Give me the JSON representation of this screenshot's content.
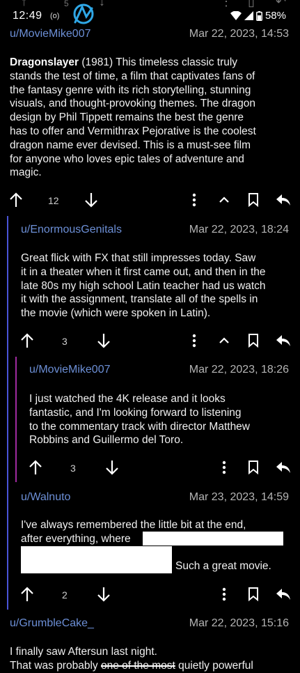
{
  "status": {
    "time": "12:49",
    "battery": "58%",
    "small_indicator": "(o)"
  },
  "comments": [
    {
      "author": "u/MovieMike007",
      "date": "Mar 22, 2023, 14:53",
      "title": "Dragonslayer",
      "lines": [
        " (1981) This timeless classic truly",
        "stands the test of time, a film that captivates fans of",
        "the fantasy genre with its rich storytelling, stunning",
        "visuals, and thought-provoking themes. The dragon",
        "design by Phil Tippett remains the best the genre",
        "has to offer and Vermithrax Pejorative is the coolest",
        "dragon name ever devised.  This is a must-see film",
        "for anyone who loves epic tales of adventure and",
        "magic."
      ],
      "votes": "12"
    },
    {
      "author": "u/EnormousGenitals",
      "date": "Mar 22, 2023, 18:24",
      "lines": [
        "Great flick with FX that still impresses today. Saw",
        "it in a theater when it first came out, and then in the",
        "late 80s my high school Latin teacher had us watch",
        "it with the assignment, translate all of the spells in",
        "the movie (which were spoken in Latin)."
      ],
      "votes": "3"
    },
    {
      "author": "u/MovieMike007",
      "date": "Mar 22, 2023, 18:26",
      "lines": [
        "I just watched the 4K release and it looks",
        "fantastic, and I'm looking forward to listening",
        "to the commentary track with director Matthew",
        "Robbins and Guillermo del Toro."
      ],
      "votes": "3"
    },
    {
      "author": "u/Walnuto",
      "date": "Mar 23, 2023, 14:59",
      "lines": [
        "I've always remembered the little bit at the end,",
        "after everything, where"
      ],
      "tail": "Such a great movie.",
      "votes": "2"
    },
    {
      "author": "u/GrumbleCake_",
      "date": "Mar 22, 2023, 15:16",
      "line1": "I finally saw Aftersun last night.",
      "line2_pre": "That was probably ",
      "line2_strike": "one of the most",
      "line2_post": " quietly powerful"
    }
  ],
  "colors": {
    "author": "#6c8fd6",
    "thread1": "#4a55d8",
    "thread2": "#a02aa0",
    "background": "#000000"
  }
}
